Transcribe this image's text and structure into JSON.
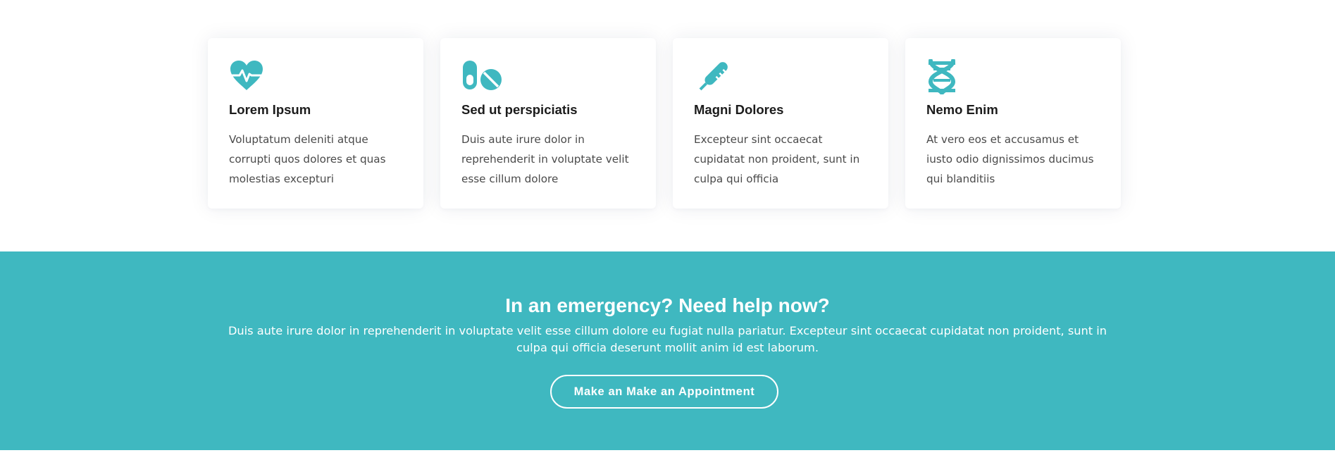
{
  "features": [
    {
      "icon": "heartbeat-icon",
      "title": "Lorem Ipsum",
      "text": "Voluptatum deleniti atque corrupti quos dolores et quas molestias excepturi"
    },
    {
      "icon": "pills-icon",
      "title": "Sed ut perspiciatis",
      "text": "Duis aute irure dolor in reprehenderit in voluptate velit esse cillum dolore"
    },
    {
      "icon": "thermometer-icon",
      "title": "Magni Dolores",
      "text": "Excepteur sint occaecat cupidatat non proident, sunt in culpa qui officia"
    },
    {
      "icon": "dna-icon",
      "title": "Nemo Enim",
      "text": "At vero eos et accusamus et iusto odio dignissimos ducimus qui blanditiis"
    }
  ],
  "cta": {
    "title": "In an emergency? Need help now?",
    "text": "Duis aute irure dolor in reprehenderit in voluptate velit esse cillum dolore eu fugiat nulla pariatur. Excepteur sint occaecat cupidatat non proident, sunt in culpa qui officia deserunt mollit anim id est laborum.",
    "button_label": "Make an Make an Appointment"
  },
  "colors": {
    "accent": "#3fb8c0",
    "title": "#1b1b1b",
    "body_text": "#4a4a4a",
    "background": "#ffffff"
  }
}
